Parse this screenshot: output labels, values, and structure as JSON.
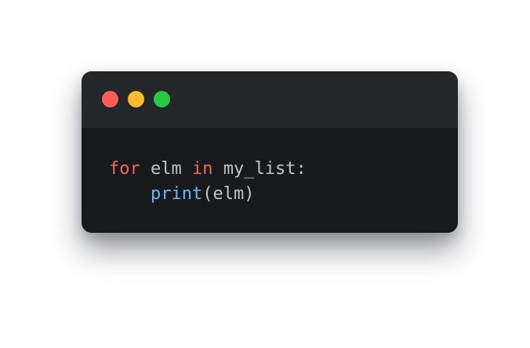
{
  "window": {
    "controls": [
      {
        "name": "close",
        "color": "#ff5f57"
      },
      {
        "name": "minimize",
        "color": "#febc2e"
      },
      {
        "name": "maximize",
        "color": "#28c840"
      }
    ]
  },
  "code": {
    "language": "python",
    "lines": [
      {
        "tokens": [
          {
            "type": "keyword",
            "text": "for"
          },
          {
            "type": "text",
            "text": " elm "
          },
          {
            "type": "keyword",
            "text": "in"
          },
          {
            "type": "text",
            "text": " my_list:"
          }
        ]
      },
      {
        "tokens": [
          {
            "type": "text",
            "text": "    "
          },
          {
            "type": "function",
            "text": "print"
          },
          {
            "type": "text",
            "text": "(elm)"
          }
        ]
      }
    ]
  },
  "colors": {
    "window_background": "#17191b",
    "titlebar_background": "#242729",
    "keyword": "#ea6962",
    "function": "#6cb6ff",
    "text": "#c0c5cc"
  }
}
